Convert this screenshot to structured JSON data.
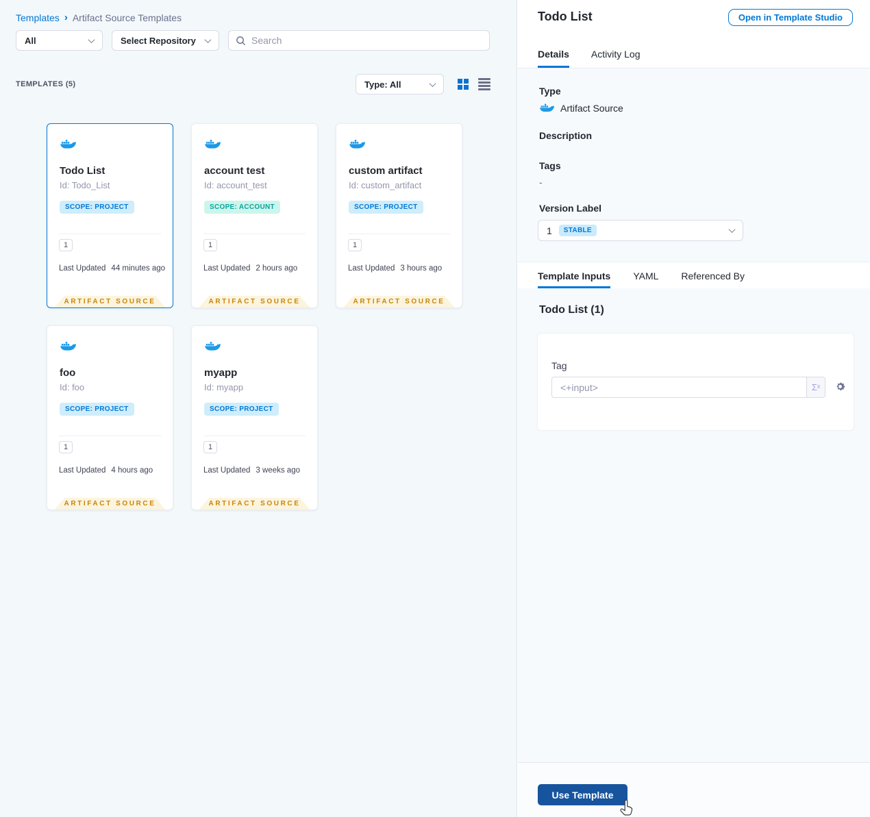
{
  "colors": {
    "accent": "#0278d5",
    "docker_blue": "#1c99e9",
    "artifact_label": "#c8860b",
    "artifact_label_bg": "#fcf4dd",
    "scope_project_bg": "#cfedfb",
    "scope_account_bg": "#cdf5ec",
    "scope_account_text": "#06a59d",
    "use_button_bg": "#17549e"
  },
  "breadcrumb": {
    "root": "Templates",
    "separator": "›",
    "current": "Artifact Source Templates"
  },
  "filters": {
    "scope": "All",
    "repository": "Select Repository",
    "search_placeholder": "Search"
  },
  "list_header": {
    "count": "TEMPLATES (5)",
    "type_filter": "Type: All"
  },
  "labels": {
    "last_updated": "Last Updated",
    "artifact_source": "ARTIFACT SOURCE"
  },
  "cards": [
    {
      "title": "Todo List",
      "id": "Id: Todo_List",
      "scope": "SCOPE: PROJECT",
      "version": "1",
      "updated": "44 minutes ago"
    },
    {
      "title": "account test",
      "id": "Id: account_test",
      "scope": "SCOPE: ACCOUNT",
      "version": "1",
      "updated": "2 hours ago"
    },
    {
      "title": "custom artifact",
      "id": "Id: custom_artifact",
      "scope": "SCOPE: PROJECT",
      "version": "1",
      "updated": "3 hours ago"
    },
    {
      "title": "foo",
      "id": "Id: foo",
      "scope": "SCOPE: PROJECT",
      "version": "1",
      "updated": "4 hours ago"
    },
    {
      "title": "myapp",
      "id": "Id: myapp",
      "scope": "SCOPE: PROJECT",
      "version": "1",
      "updated": "3 weeks ago"
    }
  ],
  "panel": {
    "title": "Todo List",
    "open_button": "Open in Template Studio",
    "tabs": {
      "details": "Details",
      "activity_log": "Activity Log"
    },
    "type_label": "Type",
    "type_value": "Artifact Source",
    "description_label": "Description",
    "tags_label": "Tags",
    "tags_value": "-",
    "version_label": "Version Label",
    "version_number": "1",
    "version_badge": "STABLE",
    "input_tabs": {
      "template_inputs": "Template Inputs",
      "yaml": "YAML",
      "referenced_by": "Referenced By"
    },
    "inputs_title": "Todo List (1)",
    "tag_label": "Tag",
    "tag_placeholder": "<+input>",
    "expression_symbol": "Σˣ",
    "use_button": "Use Template"
  }
}
